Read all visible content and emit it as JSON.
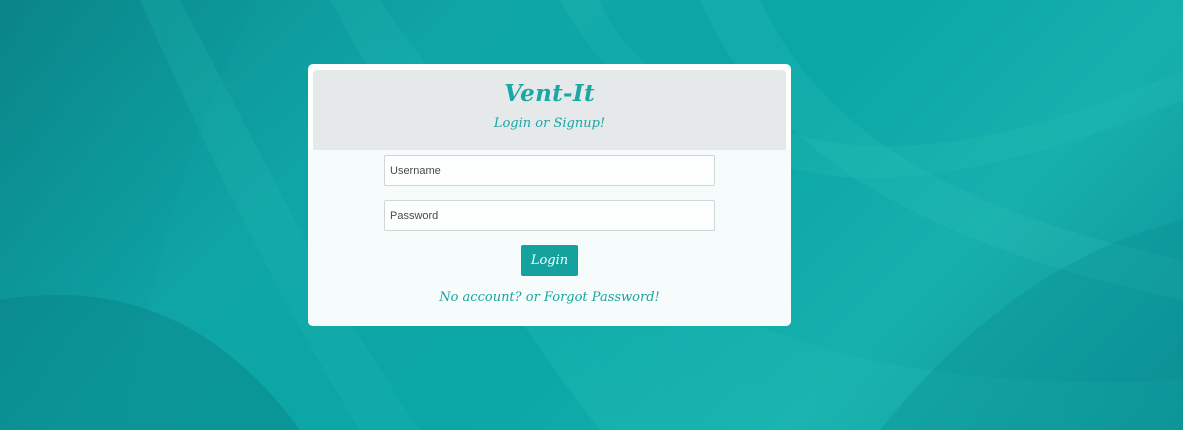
{
  "header": {
    "brand": "Vent-It",
    "subtitle": "Login or Signup!"
  },
  "form": {
    "username_placeholder": "Username",
    "password_placeholder": "Password",
    "login_label": "Login",
    "help_link": "No account? or Forgot Password!"
  },
  "colors": {
    "accent": "#13a29d",
    "header_bg": "#e6e9e9",
    "background": "#0fa5a6"
  }
}
